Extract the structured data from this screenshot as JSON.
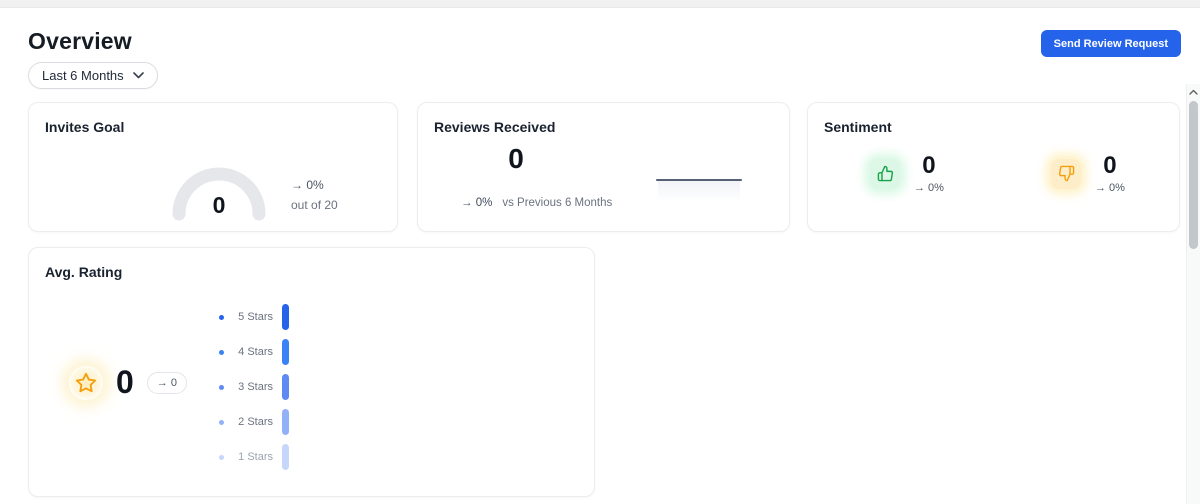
{
  "header": {
    "title": "Overview",
    "filter_label": "Last 6 Months",
    "send_review_button": "Send Review Request"
  },
  "cards": {
    "invites_goal": {
      "title": "Invites Goal",
      "value": "0",
      "change": "→ 0%",
      "goal_text": "out of 20",
      "goal_total": 20
    },
    "reviews_received": {
      "title": "Reviews Received",
      "value": "0",
      "change": "→ 0%",
      "comparison_label": "vs Previous 6 Months"
    },
    "sentiment": {
      "title": "Sentiment",
      "positive": {
        "icon": "thumbs-up-icon",
        "value": "0",
        "change": "→ 0%",
        "color": "#16a34a"
      },
      "negative": {
        "icon": "thumbs-down-icon",
        "value": "0",
        "change": "→ 0%",
        "color": "#f59e0b"
      }
    },
    "avg_rating": {
      "title": "Avg. Rating",
      "value": "0",
      "change": "→ 0",
      "icon": "star-icon",
      "breakdown": [
        {
          "label": "5 Stars",
          "value": 0,
          "color": "#2563eb"
        },
        {
          "label": "4 Stars",
          "value": 0,
          "color": "#3b82f6"
        },
        {
          "label": "3 Stars",
          "value": 0,
          "color": "#5f8af4"
        },
        {
          "label": "2 Stars",
          "value": 0,
          "color": "#93b1f8"
        },
        {
          "label": "1 Stars",
          "value": 0,
          "color": "#c7d7fb"
        }
      ]
    }
  },
  "colors": {
    "accent_blue": "#2563eb",
    "positive_green": "#16a34a",
    "negative_amber": "#f59e0b",
    "gauge_track": "#e5e7eb",
    "sparkline": "#566178"
  }
}
